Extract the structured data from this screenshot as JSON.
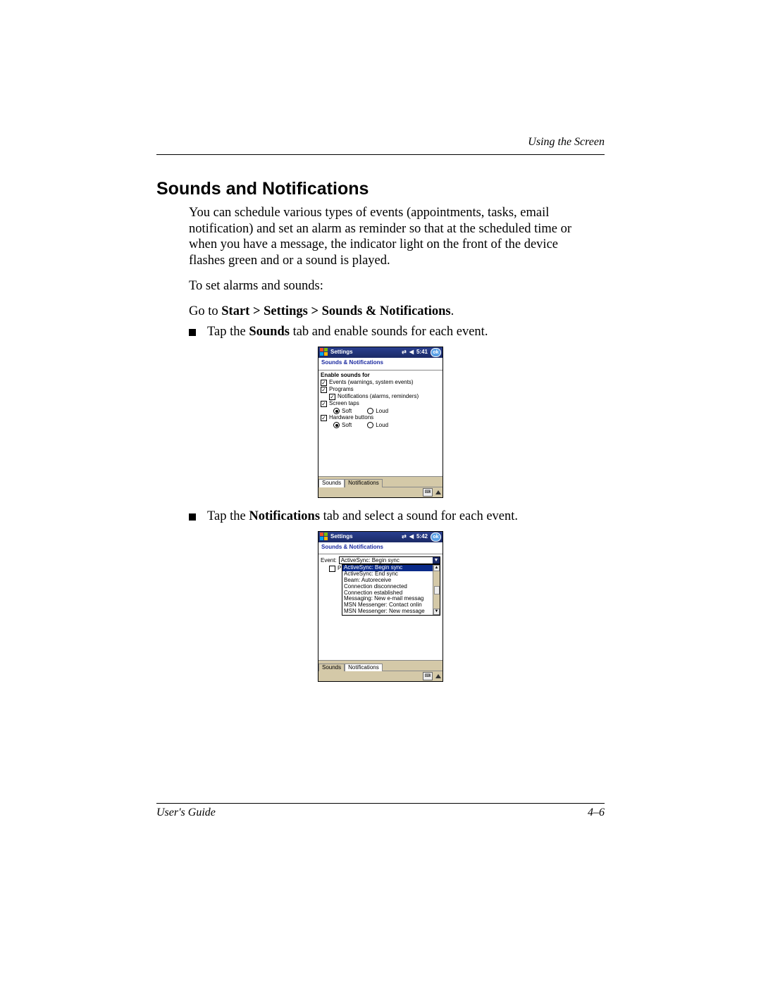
{
  "header": {
    "running_head": "Using the Screen"
  },
  "section_title": "Sounds and Notifications",
  "para1": "You can schedule various types of events (appointments, tasks, email notification) and set an alarm as reminder so that at the scheduled time or when you have a message, the indicator light on the front of the device flashes green and or a sound is played.",
  "para2": "To set alarms and sounds:",
  "nav": {
    "prefix": "Go to ",
    "path": "Start > Settings > Sounds & Notifications",
    "suffix": "."
  },
  "bullet1": {
    "t0": "Tap the ",
    "b": "Sounds",
    "t1": " tab and enable sounds for each event."
  },
  "bullet2": {
    "t0": "Tap the ",
    "b": "Notifications",
    "t1": " tab and select a sound for each event."
  },
  "ppc_common": {
    "title": "Settings",
    "subtitle": "Sounds & Notifications",
    "ok": "ok",
    "tabs": {
      "sounds": "Sounds",
      "notifications": "Notifications"
    },
    "icons": {
      "signal": "⇄",
      "speaker": "◀",
      "kb": "⌨"
    }
  },
  "ppc1": {
    "time": "5:41",
    "enable_label": "Enable sounds for",
    "events": "Events (warnings, system events)",
    "programs": "Programs",
    "notifications": "Notifications (alarms, reminders)",
    "screen_taps": "Screen taps",
    "hardware_buttons": "Hardware buttons",
    "soft": "Soft",
    "loud": "Loud"
  },
  "ppc2": {
    "time": "5:42",
    "event_label": "Event:",
    "selected": "ActiveSync: Begin sync",
    "p_label": "P",
    "items": [
      "ActiveSync: Begin sync",
      "ActiveSync: End sync",
      "Beam: Autoreceive",
      "Connection disconnected",
      "Connection established",
      "Messaging: New e-mail messag",
      "MSN Messenger: Contact onlin",
      "MSN Messenger: New message"
    ]
  },
  "footer": {
    "left": "User's Guide",
    "right": "4–6"
  }
}
